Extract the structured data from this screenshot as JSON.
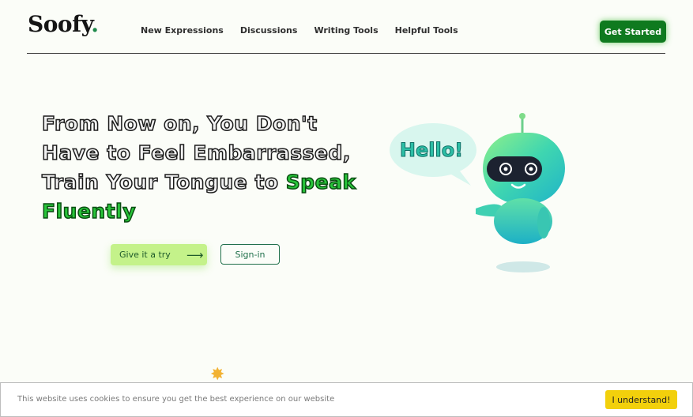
{
  "brand": {
    "name": "Soofy",
    "dot": "."
  },
  "nav": {
    "items": [
      {
        "label": "New Expressions"
      },
      {
        "label": "Discussions"
      },
      {
        "label": "Writing Tools"
      },
      {
        "label": "Helpful Tools"
      }
    ],
    "cta_label": "Get Started"
  },
  "hero": {
    "line1": "From Now on, You Don't",
    "line2": "Have to Feel Embarrassed,",
    "line3_prefix": "Train Your Tongue to ",
    "highlight1": "Speak",
    "highlight2": "Fluently",
    "try_label": "Give it a try",
    "try_arrow": "⟶",
    "signin_label": "Sign-in"
  },
  "illustration": {
    "speech_text": "Hello!"
  },
  "cookie": {
    "message": "This website uses cookies to ensure you get the best experience on our website",
    "button_label": "I understand!"
  },
  "colors": {
    "brand_green": "#0f7a1f",
    "highlight_green": "#28c53a",
    "try_bg": "#c4f28a",
    "cookie_button": "#f2d00c"
  }
}
